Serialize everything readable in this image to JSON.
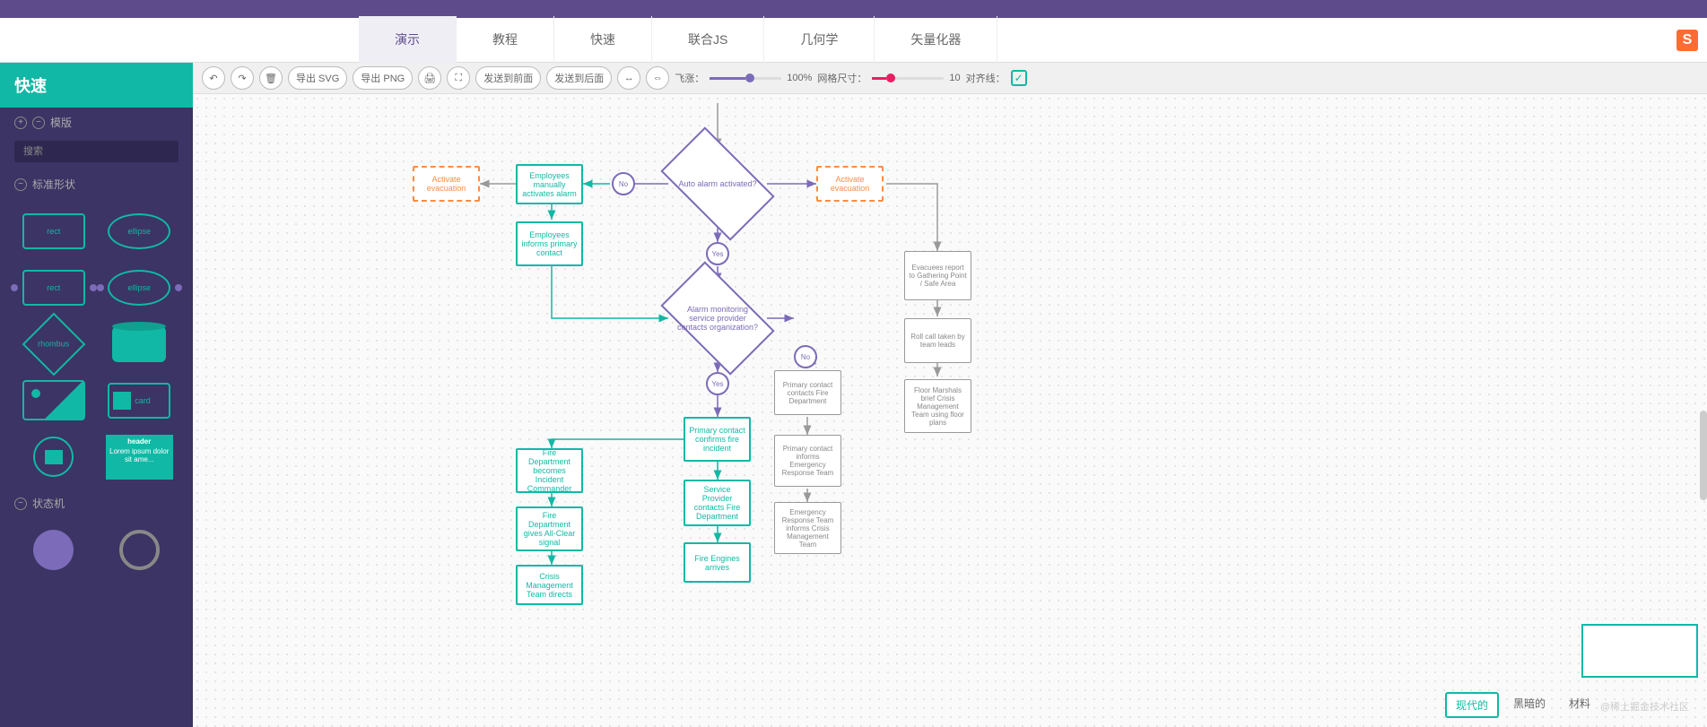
{
  "nav": {
    "tabs": [
      "演示",
      "教程",
      "快速",
      "联合JS",
      "几何学",
      "矢量化器"
    ],
    "active": 0,
    "logo": "S"
  },
  "sidebar": {
    "title": "快速",
    "sections": {
      "templates": "模版",
      "search_placeholder": "搜索",
      "standard_shapes": "标准形状",
      "state_machine": "状态机"
    },
    "shapes": {
      "rect": "rect",
      "ellipse": "ellipse",
      "rhombus": "rhombus",
      "card": "card",
      "header": "header",
      "lorem": "Lorem ipsum dolor sit ame...",
      "state": "state"
    }
  },
  "toolbar": {
    "export_svg": "导出 SVG",
    "export_png": "导出 PNG",
    "send_front": "发送到前面",
    "send_back": "发送到后面",
    "zoom_label": "飞涨：",
    "zoom_value": "100%",
    "grid_label": "网格尺寸：",
    "grid_value": "10",
    "snap_label": "对齐线："
  },
  "diagram": {
    "auto_alarm": "Auto alarm activated?",
    "activate_evac_left": "Activate evacuation",
    "activate_evac_right": "Activate evacuation",
    "emp_manual": "Employees manually activates alarm",
    "emp_informs": "Employees informs primary contact",
    "alarm_monitor": "Alarm monitoring service provider contacts organization?",
    "primary_confirm": "Primary contact confirms fire incident",
    "service_provider": "Service Provider contacts Fire Department",
    "fire_arrives": "Fire Engines arrives",
    "fire_commander": "Fire Department becomes Incident Commander",
    "fire_clear": "Fire Department gives All-Clear signal",
    "crisis_mgmt": "Crisis Management Team directs",
    "primary_fire": "Primary contact contacts Fire Department",
    "primary_informs": "Primary contact informs Emergency Response Team",
    "emergency_informs": "Emergency Response Team informs Crisis Management Team",
    "evacuees": "Evacuees report to Gathering Point / Safe Area",
    "roll_call": "Roll call taken by team leads",
    "floor_marshals": "Floor Marshals brief Crisis Management Team using floor plans",
    "no": "No",
    "yes": "Yes"
  },
  "bottom": {
    "modern": "现代的",
    "dark": "黑暗的",
    "material": "材料"
  },
  "watermark": "@稀土掘金技术社区"
}
